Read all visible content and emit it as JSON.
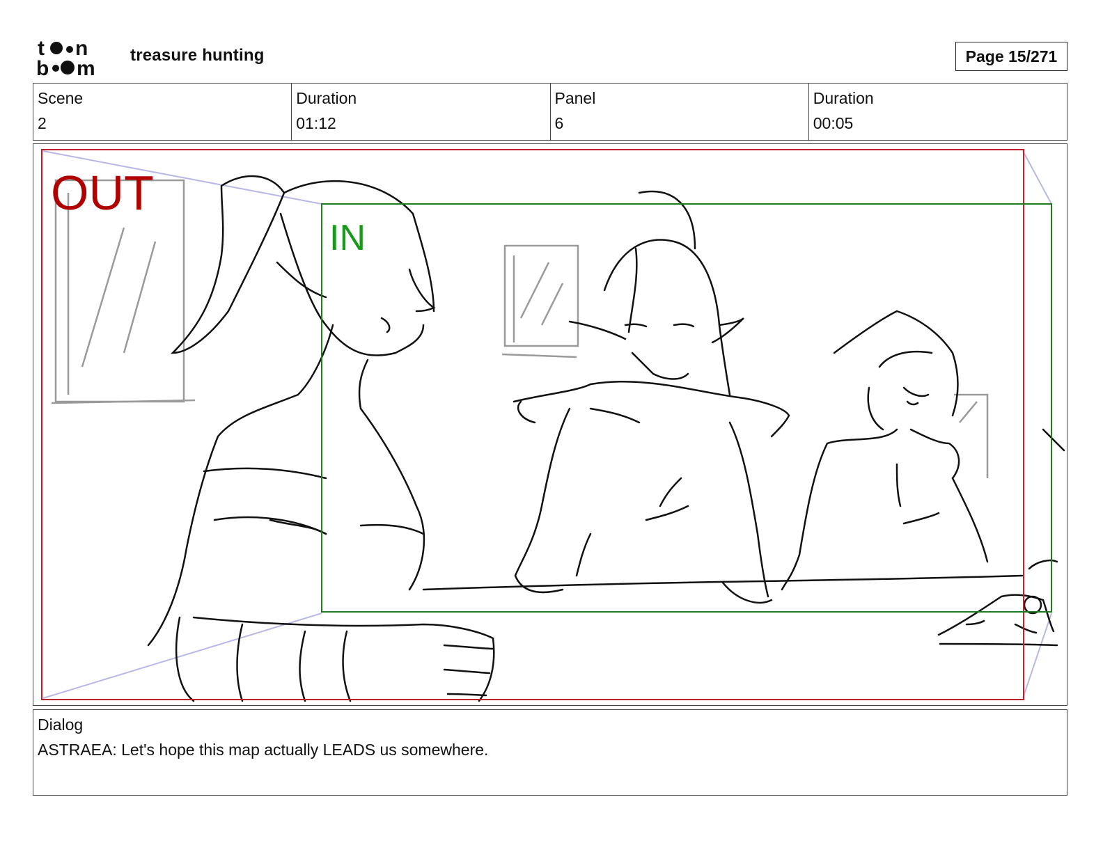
{
  "header": {
    "logo_text": "toon boom",
    "project_title": "treasure hunting",
    "page_label": "Page  15/271"
  },
  "info": {
    "scene_label": "Scene",
    "scene_value": "2",
    "scene_duration_label": "Duration",
    "scene_duration_value": "01:12",
    "panel_label": "Panel",
    "panel_value": "6",
    "panel_duration_label": "Duration",
    "panel_duration_value": "00:05"
  },
  "panel": {
    "out_label": "OUT",
    "in_label": "IN",
    "out_color": "#b00000",
    "in_color": "#1a9a1a"
  },
  "dialog": {
    "label": "Dialog",
    "text": "ASTRAEA: Let's hope this map actually LEADS us somewhere."
  }
}
